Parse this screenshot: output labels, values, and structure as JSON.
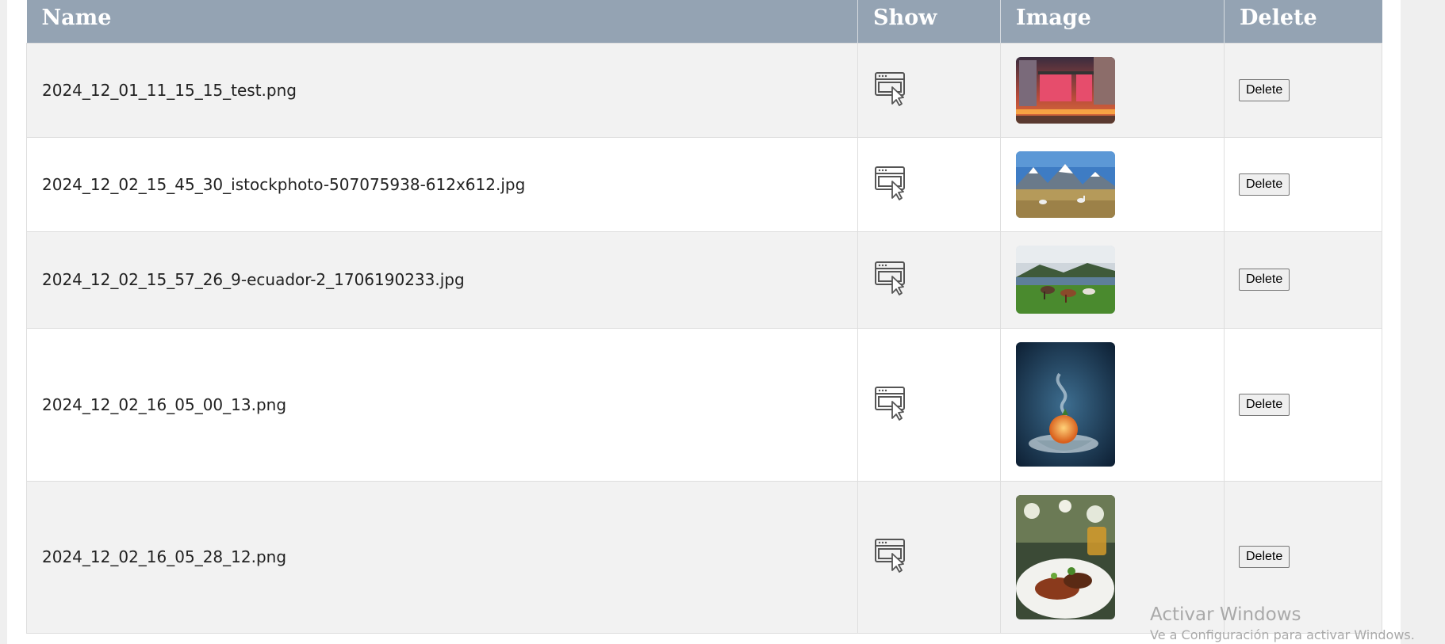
{
  "table": {
    "headers": {
      "name": "Name",
      "show": "Show",
      "image": "Image",
      "delete": "Delete"
    },
    "rows": [
      {
        "name": "2024_12_01_11_15_15_test.png",
        "image_icon": "city-billboard-image",
        "delete_label": "Delete"
      },
      {
        "name": "2024_12_02_15_45_30_istockphoto-507075938-612x612.jpg",
        "image_icon": "snowy-mountains-llamas-image",
        "delete_label": "Delete"
      },
      {
        "name": "2024_12_02_15_57_26_9-ecuador-2_1706190233.jpg",
        "image_icon": "llamas-grazing-lake-image",
        "delete_label": "Delete"
      },
      {
        "name": "2024_12_02_16_05_00_13.png",
        "image_icon": "smoking-dessert-image",
        "delete_label": "Delete"
      },
      {
        "name": "2024_12_02_16_05_28_12.png",
        "image_icon": "plated-food-image",
        "delete_label": "Delete"
      }
    ]
  },
  "icons": {
    "show": "browser-window-cursor-icon"
  },
  "windows_watermark": {
    "title": "Activar Windows",
    "subtitle": "Ve a Configuración para activar Windows."
  },
  "colors": {
    "header_bg": "#94a3b3",
    "row_odd_bg": "#f2f2f2",
    "row_even_bg": "#ffffff"
  }
}
